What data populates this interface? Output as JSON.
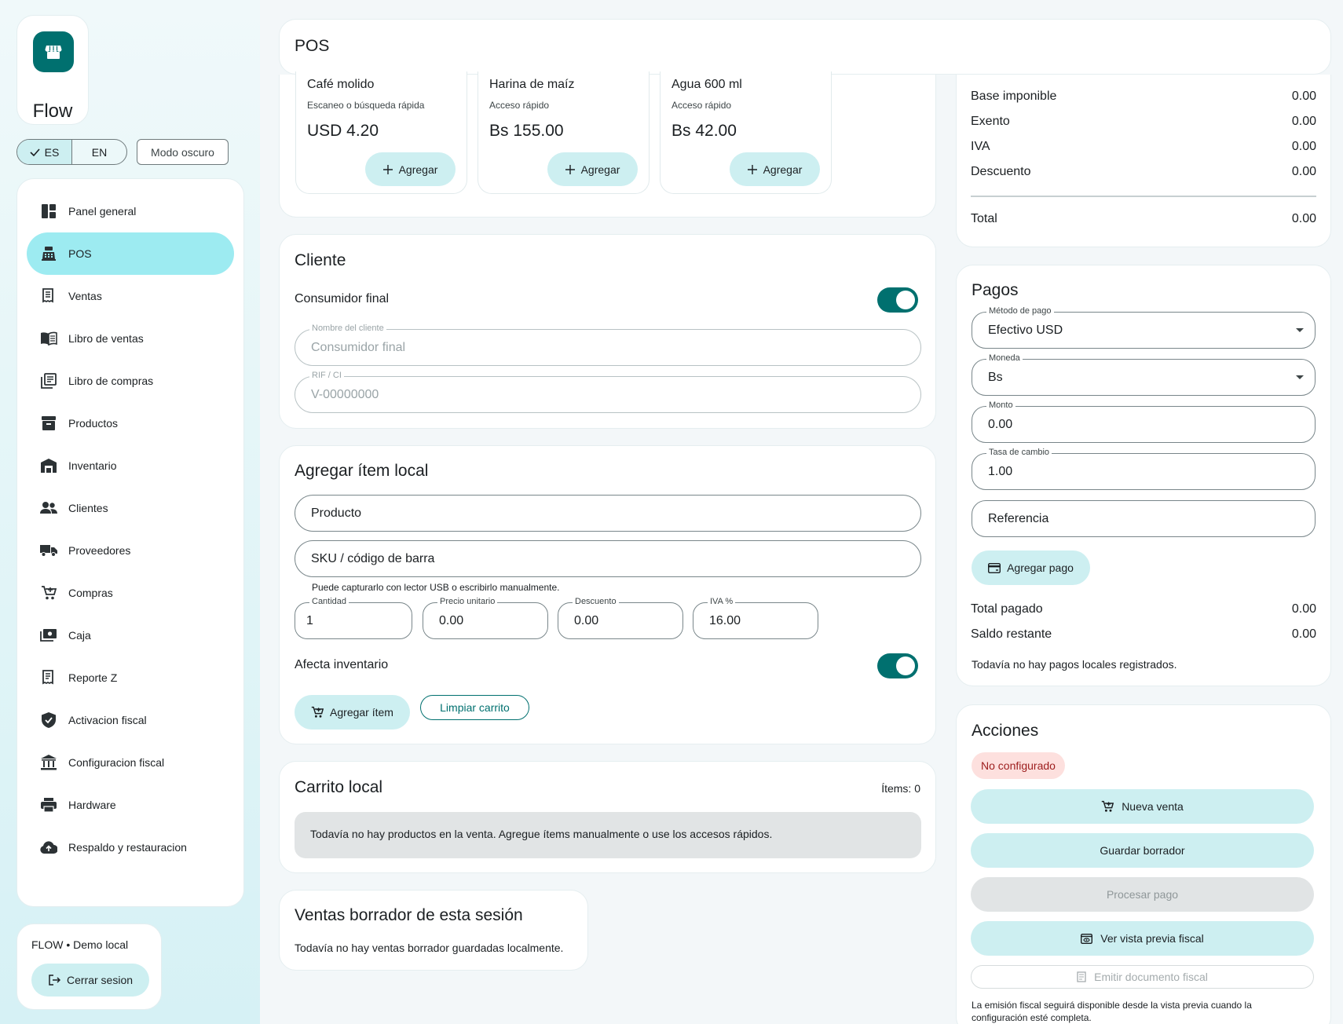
{
  "app": {
    "name": "Flow"
  },
  "language": {
    "options": [
      "ES",
      "EN"
    ],
    "selected": "ES",
    "dark_mode_label": "Modo oscuro"
  },
  "sidebar": {
    "items": [
      {
        "label": "Panel general",
        "icon": "dashboard-icon"
      },
      {
        "label": "POS",
        "icon": "point-of-sale-icon",
        "active": true
      },
      {
        "label": "Ventas",
        "icon": "receipt-icon"
      },
      {
        "label": "Libro de ventas",
        "icon": "book-icon"
      },
      {
        "label": "Libro de compras",
        "icon": "library-icon"
      },
      {
        "label": "Productos",
        "icon": "archive-icon"
      },
      {
        "label": "Inventario",
        "icon": "warehouse-icon"
      },
      {
        "label": "Clientes",
        "icon": "people-icon"
      },
      {
        "label": "Proveedores",
        "icon": "truck-icon"
      },
      {
        "label": "Compras",
        "icon": "cart-icon"
      },
      {
        "label": "Caja",
        "icon": "cash-icon"
      },
      {
        "label": "Reporte Z",
        "icon": "report-icon"
      },
      {
        "label": "Activacion fiscal",
        "icon": "shield-check-icon"
      },
      {
        "label": "Configuracion fiscal",
        "icon": "bank-icon"
      },
      {
        "label": "Hardware",
        "icon": "printer-icon"
      },
      {
        "label": "Respaldo y restauracion",
        "icon": "cloud-upload-icon"
      }
    ]
  },
  "user": {
    "name": "FLOW • Demo local",
    "logout_label": "Cerrar sesion"
  },
  "header": {
    "title": "POS"
  },
  "quick_products": [
    {
      "name": "Café molido",
      "subtitle": "Escaneo o búsqueda rápida",
      "price": "USD 4.20",
      "button": "Agregar"
    },
    {
      "name": "Harina de maíz",
      "subtitle": "Acceso rápido",
      "price": "Bs 155.00",
      "button": "Agregar"
    },
    {
      "name": "Agua 600 ml",
      "subtitle": "Acceso rápido",
      "price": "Bs 42.00",
      "button": "Agregar"
    }
  ],
  "cliente": {
    "title": "Cliente",
    "consumidor_final_label": "Consumidor final",
    "consumidor_final_on": true,
    "nombre_label": "Nombre del cliente",
    "nombre_placeholder": "Consumidor final",
    "rif_label": "RIF / CI",
    "rif_placeholder": "V-00000000"
  },
  "agregar_item": {
    "title": "Agregar ítem local",
    "producto_placeholder": "Producto",
    "sku_placeholder": "SKU / código de barra",
    "sku_help": "Puede capturarlo con lector USB o escribirlo manualmente.",
    "cantidad_label": "Cantidad",
    "cantidad_value": "1",
    "precio_label": "Precio unitario",
    "precio_value": "0.00",
    "descuento_label": "Descuento",
    "descuento_value": "0.00",
    "iva_label": "IVA %",
    "iva_value": "16.00",
    "afecta_inventario_label": "Afecta inventario",
    "afecta_inventario_on": true,
    "agregar_button": "Agregar ítem",
    "limpiar_button": "Limpiar carrito"
  },
  "carrito": {
    "title": "Carrito local",
    "items_count": "Ítems: 0",
    "empty_message": "Todavía no hay productos en la venta. Agregue ítems manualmente o use los accesos rápidos."
  },
  "borradores": {
    "title": "Ventas borrador de esta sesión",
    "empty_message": "Todavía no hay ventas borrador guardadas localmente."
  },
  "resumen": {
    "rows": [
      {
        "label": "Base imponible",
        "value": "0.00"
      },
      {
        "label": "Exento",
        "value": "0.00"
      },
      {
        "label": "IVA",
        "value": "0.00"
      },
      {
        "label": "Descuento",
        "value": "0.00"
      }
    ],
    "total_label": "Total",
    "total_value": "0.00"
  },
  "pagos": {
    "title": "Pagos",
    "metodo_label": "Método de pago",
    "metodo_value": "Efectivo USD",
    "moneda_label": "Moneda",
    "moneda_value": "Bs",
    "monto_label": "Monto",
    "monto_value": "0.00",
    "tasa_label": "Tasa de cambio",
    "tasa_value": "1.00",
    "referencia_placeholder": "Referencia",
    "agregar_pago_button": "Agregar pago",
    "total_pagado_label": "Total pagado",
    "total_pagado_value": "0.00",
    "saldo_label": "Saldo restante",
    "saldo_value": "0.00",
    "empty_message": "Todavía no hay pagos locales registrados."
  },
  "acciones": {
    "title": "Acciones",
    "status_badge": "No configurado",
    "nueva_venta": "Nueva venta",
    "guardar_borrador": "Guardar borrador",
    "procesar_pago": "Procesar pago",
    "ver_vista_previa": "Ver vista previa fiscal",
    "emitir_documento": "Emitir documento fiscal",
    "footnote": "La emisión fiscal seguirá disponible desde la vista previa cuando la configuración esté completa."
  },
  "colors": {
    "primary": "#00706f",
    "tonal": "#cdeff1",
    "active_nav": "#9debf1",
    "badge_bg": "#fde0de",
    "badge_text": "#9c1c1c"
  }
}
